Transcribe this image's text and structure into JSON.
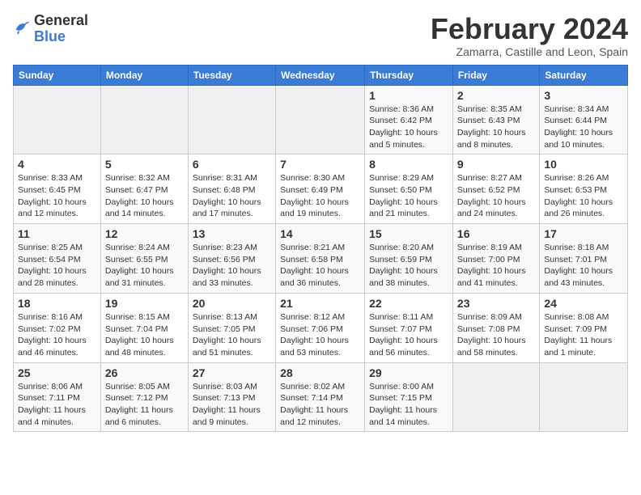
{
  "header": {
    "logo_general": "General",
    "logo_blue": "Blue",
    "month_title": "February 2024",
    "subtitle": "Zamarra, Castille and Leon, Spain"
  },
  "weekdays": [
    "Sunday",
    "Monday",
    "Tuesday",
    "Wednesday",
    "Thursday",
    "Friday",
    "Saturday"
  ],
  "weeks": [
    [
      {
        "day": "",
        "info": ""
      },
      {
        "day": "",
        "info": ""
      },
      {
        "day": "",
        "info": ""
      },
      {
        "day": "",
        "info": ""
      },
      {
        "day": "1",
        "info": "Sunrise: 8:36 AM\nSunset: 6:42 PM\nDaylight: 10 hours\nand 5 minutes."
      },
      {
        "day": "2",
        "info": "Sunrise: 8:35 AM\nSunset: 6:43 PM\nDaylight: 10 hours\nand 8 minutes."
      },
      {
        "day": "3",
        "info": "Sunrise: 8:34 AM\nSunset: 6:44 PM\nDaylight: 10 hours\nand 10 minutes."
      }
    ],
    [
      {
        "day": "4",
        "info": "Sunrise: 8:33 AM\nSunset: 6:45 PM\nDaylight: 10 hours\nand 12 minutes."
      },
      {
        "day": "5",
        "info": "Sunrise: 8:32 AM\nSunset: 6:47 PM\nDaylight: 10 hours\nand 14 minutes."
      },
      {
        "day": "6",
        "info": "Sunrise: 8:31 AM\nSunset: 6:48 PM\nDaylight: 10 hours\nand 17 minutes."
      },
      {
        "day": "7",
        "info": "Sunrise: 8:30 AM\nSunset: 6:49 PM\nDaylight: 10 hours\nand 19 minutes."
      },
      {
        "day": "8",
        "info": "Sunrise: 8:29 AM\nSunset: 6:50 PM\nDaylight: 10 hours\nand 21 minutes."
      },
      {
        "day": "9",
        "info": "Sunrise: 8:27 AM\nSunset: 6:52 PM\nDaylight: 10 hours\nand 24 minutes."
      },
      {
        "day": "10",
        "info": "Sunrise: 8:26 AM\nSunset: 6:53 PM\nDaylight: 10 hours\nand 26 minutes."
      }
    ],
    [
      {
        "day": "11",
        "info": "Sunrise: 8:25 AM\nSunset: 6:54 PM\nDaylight: 10 hours\nand 28 minutes."
      },
      {
        "day": "12",
        "info": "Sunrise: 8:24 AM\nSunset: 6:55 PM\nDaylight: 10 hours\nand 31 minutes."
      },
      {
        "day": "13",
        "info": "Sunrise: 8:23 AM\nSunset: 6:56 PM\nDaylight: 10 hours\nand 33 minutes."
      },
      {
        "day": "14",
        "info": "Sunrise: 8:21 AM\nSunset: 6:58 PM\nDaylight: 10 hours\nand 36 minutes."
      },
      {
        "day": "15",
        "info": "Sunrise: 8:20 AM\nSunset: 6:59 PM\nDaylight: 10 hours\nand 38 minutes."
      },
      {
        "day": "16",
        "info": "Sunrise: 8:19 AM\nSunset: 7:00 PM\nDaylight: 10 hours\nand 41 minutes."
      },
      {
        "day": "17",
        "info": "Sunrise: 8:18 AM\nSunset: 7:01 PM\nDaylight: 10 hours\nand 43 minutes."
      }
    ],
    [
      {
        "day": "18",
        "info": "Sunrise: 8:16 AM\nSunset: 7:02 PM\nDaylight: 10 hours\nand 46 minutes."
      },
      {
        "day": "19",
        "info": "Sunrise: 8:15 AM\nSunset: 7:04 PM\nDaylight: 10 hours\nand 48 minutes."
      },
      {
        "day": "20",
        "info": "Sunrise: 8:13 AM\nSunset: 7:05 PM\nDaylight: 10 hours\nand 51 minutes."
      },
      {
        "day": "21",
        "info": "Sunrise: 8:12 AM\nSunset: 7:06 PM\nDaylight: 10 hours\nand 53 minutes."
      },
      {
        "day": "22",
        "info": "Sunrise: 8:11 AM\nSunset: 7:07 PM\nDaylight: 10 hours\nand 56 minutes."
      },
      {
        "day": "23",
        "info": "Sunrise: 8:09 AM\nSunset: 7:08 PM\nDaylight: 10 hours\nand 58 minutes."
      },
      {
        "day": "24",
        "info": "Sunrise: 8:08 AM\nSunset: 7:09 PM\nDaylight: 11 hours\nand 1 minute."
      }
    ],
    [
      {
        "day": "25",
        "info": "Sunrise: 8:06 AM\nSunset: 7:11 PM\nDaylight: 11 hours\nand 4 minutes."
      },
      {
        "day": "26",
        "info": "Sunrise: 8:05 AM\nSunset: 7:12 PM\nDaylight: 11 hours\nand 6 minutes."
      },
      {
        "day": "27",
        "info": "Sunrise: 8:03 AM\nSunset: 7:13 PM\nDaylight: 11 hours\nand 9 minutes."
      },
      {
        "day": "28",
        "info": "Sunrise: 8:02 AM\nSunset: 7:14 PM\nDaylight: 11 hours\nand 12 minutes."
      },
      {
        "day": "29",
        "info": "Sunrise: 8:00 AM\nSunset: 7:15 PM\nDaylight: 11 hours\nand 14 minutes."
      },
      {
        "day": "",
        "info": ""
      },
      {
        "day": "",
        "info": ""
      }
    ]
  ]
}
